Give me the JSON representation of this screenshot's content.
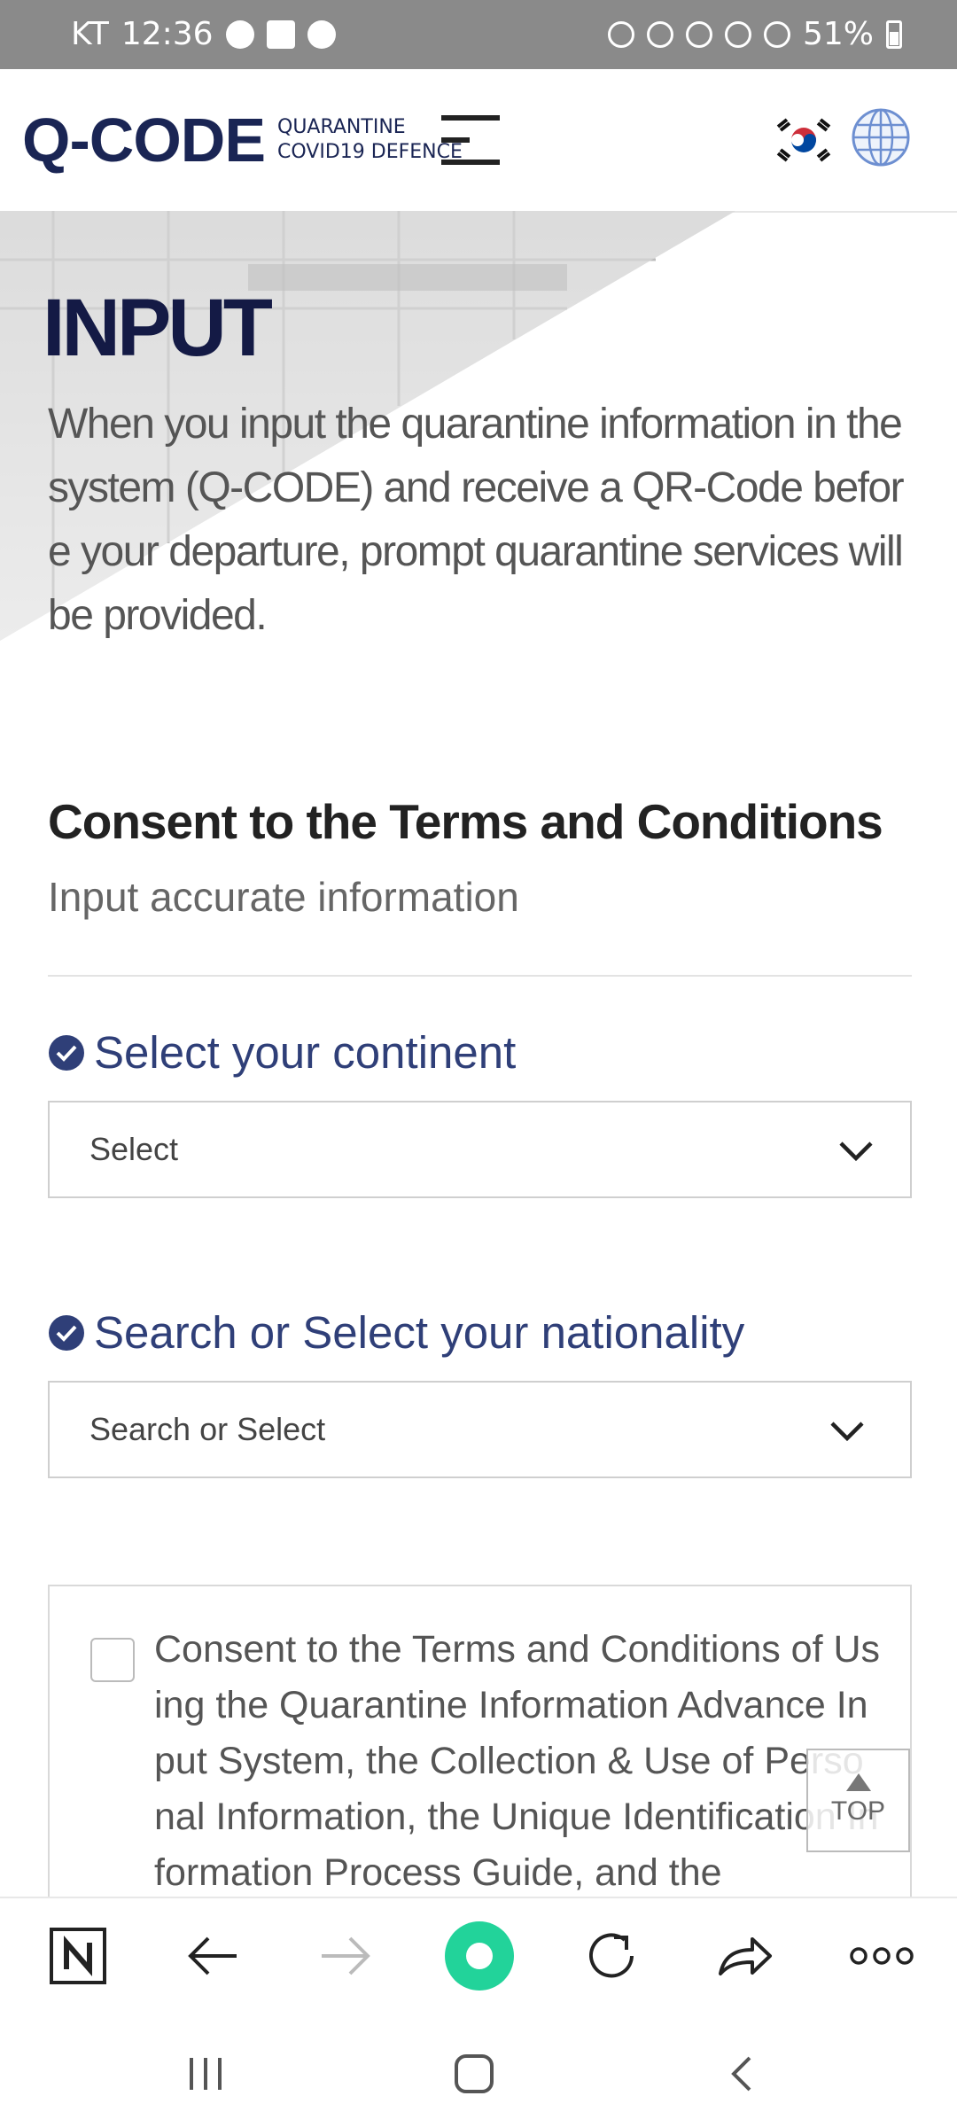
{
  "status_bar": {
    "carrier": "KT",
    "time": "12:36",
    "battery": "51%"
  },
  "header": {
    "logo_main_q": "Q",
    "logo_main_rest": "-CODE",
    "logo_sub_line1": "QUARANTINE",
    "logo_sub_line2": "COVID19 DEFENCE"
  },
  "hero": {
    "title": "INPUT",
    "description": "When you input the quarantine information in the system (Q-CODE) and receive a QR-Code before your departure, prompt quarantine services will be provided."
  },
  "consent": {
    "title": "Consent to the Terms and Conditions",
    "subtitle": "Input accurate information"
  },
  "continent": {
    "label": "Select your continent",
    "value": "Select"
  },
  "nationality": {
    "label": "Search or Select your nationality",
    "value": "Search or Select"
  },
  "terms": {
    "text": "Consent to the Terms and Conditions of Using the Quarantine Information Advance Input System, the Collection & Use of Personal Information, the Unique Identification Information Process Guide, and the"
  },
  "top_button": {
    "label": "TOP"
  },
  "colors": {
    "brand_navy": "#1a2554",
    "brand_pink": "#d6245b",
    "label_blue": "#2f3f78",
    "accent_green": "#22d39a"
  }
}
